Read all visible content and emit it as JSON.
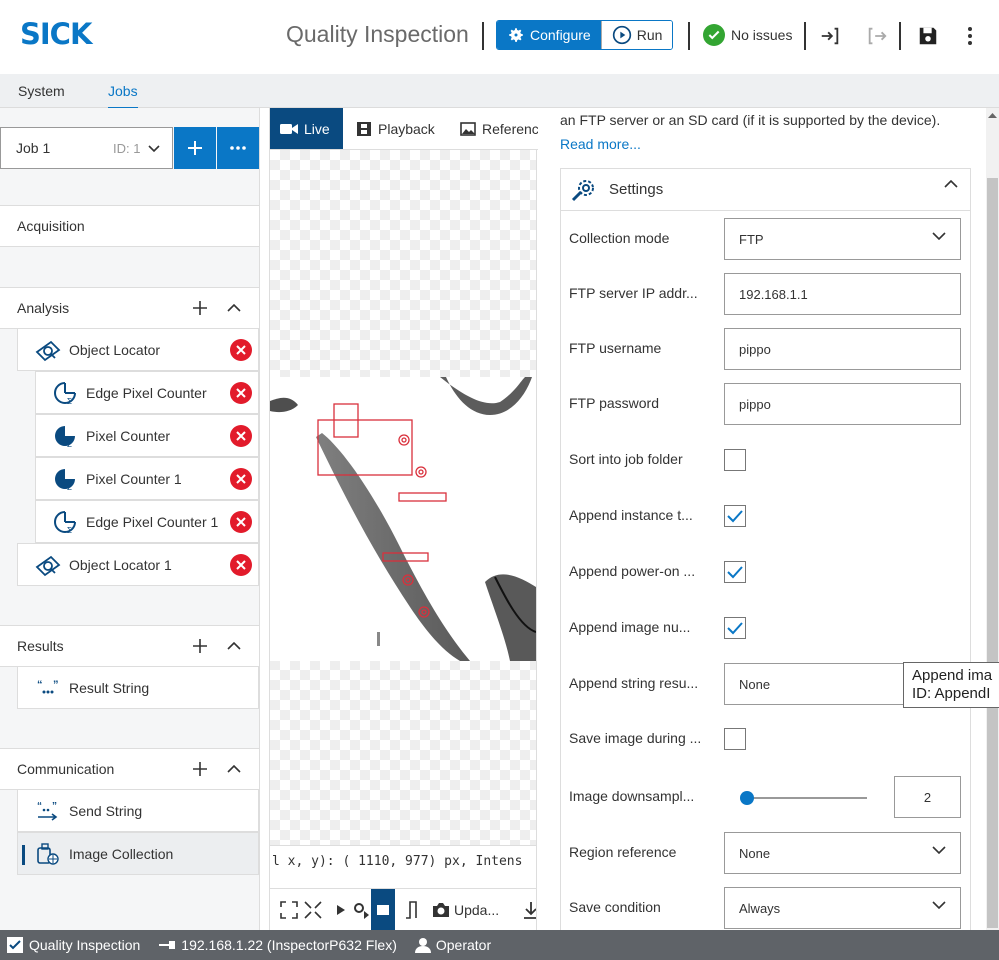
{
  "header": {
    "logo": "SICK",
    "app_title": "Quality Inspection",
    "configure_label": "Configure",
    "run_label": "Run",
    "status_label": "No issues"
  },
  "nav": {
    "tabs": [
      "System",
      "Jobs"
    ],
    "active": "Jobs"
  },
  "job": {
    "name": "Job 1",
    "id": "ID: 1"
  },
  "sections": {
    "acquisition": "Acquisition",
    "analysis": "Analysis",
    "results": "Results",
    "communication": "Communication"
  },
  "analysis_items": [
    "Object Locator",
    "Edge Pixel Counter",
    "Pixel Counter",
    "Pixel Counter 1",
    "Edge Pixel Counter 1",
    "Object Locator 1"
  ],
  "results_items": [
    "Result String"
  ],
  "communication_items": [
    "Send String",
    "Image Collection"
  ],
  "viewer": {
    "tabs": [
      "Live",
      "Playback",
      "Reference"
    ],
    "coords_text": "l x, y): ( 1110,   977) px, Intens",
    "update_label": "Upda..."
  },
  "settings": {
    "description": "an FTP server or an SD card (if it is supported by the device).",
    "read_more": "Read more...",
    "title": "Settings",
    "collection_mode_label": "Collection mode",
    "collection_mode_value": "FTP",
    "ftp_ip_label": "FTP server IP addr...",
    "ftp_ip_value": "192.168.1.1",
    "ftp_user_label": "FTP username",
    "ftp_user_value": "pippo",
    "ftp_pass_label": "FTP password",
    "ftp_pass_value": "pippo",
    "sort_label": "Sort into job folder",
    "sort_checked": false,
    "append_instance_label": "Append instance t...",
    "append_instance_checked": true,
    "append_power_label": "Append power-on ...",
    "append_power_checked": true,
    "append_image_label": "Append image nu...",
    "append_image_checked": true,
    "append_string_label": "Append string resu...",
    "append_string_value": "None",
    "save_image_label": "Save image during ...",
    "save_image_checked": false,
    "downsample_label": "Image downsampl...",
    "downsample_value": "2",
    "region_label": "Region reference",
    "region_value": "None",
    "save_condition_label": "Save condition",
    "save_condition_value": "Always"
  },
  "tooltip": {
    "line1": "Append ima",
    "line2": "ID: AppendI"
  },
  "statusbar": {
    "app": "Quality Inspection",
    "device": "192.168.1.22 (InspectorP632 Flex)",
    "user": "Operator"
  },
  "colors": {
    "accent": "#0a77c6",
    "dark_accent": "#0a4a80",
    "error": "#e21b2b",
    "ok": "#33a532",
    "roi": "#d9303c"
  }
}
